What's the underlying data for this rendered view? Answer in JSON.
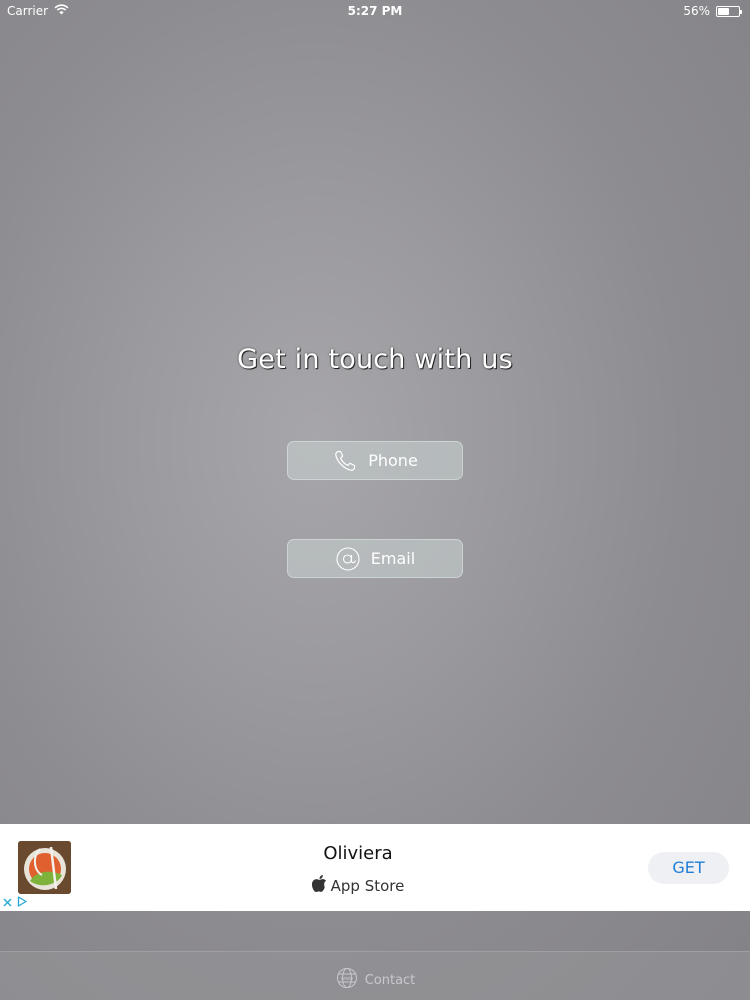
{
  "status_bar": {
    "carrier": "Carrier",
    "time": "5:27 PM",
    "battery_text": "56%",
    "battery_level": 0.56,
    "wifi_icon": "wifi-icon"
  },
  "main": {
    "headline": "Get in touch with us",
    "phone_button": {
      "label": "Phone",
      "icon": "phone-icon"
    },
    "email_button": {
      "label": "Email",
      "icon": "at-sign-icon"
    }
  },
  "ad": {
    "app_name": "Oliviera",
    "store_label": "App Store",
    "get_label": "GET",
    "store_icon": "apple-icon",
    "thumbnail_icon": "app-thumbnail"
  },
  "tab_bar": {
    "items": [
      {
        "label": "Contact",
        "icon": "globe-icon"
      }
    ]
  },
  "colors": {
    "ad_button_text": "#1f7fd6",
    "ad_choices": "#23a9d6",
    "button_bg": "#c3cccc"
  }
}
